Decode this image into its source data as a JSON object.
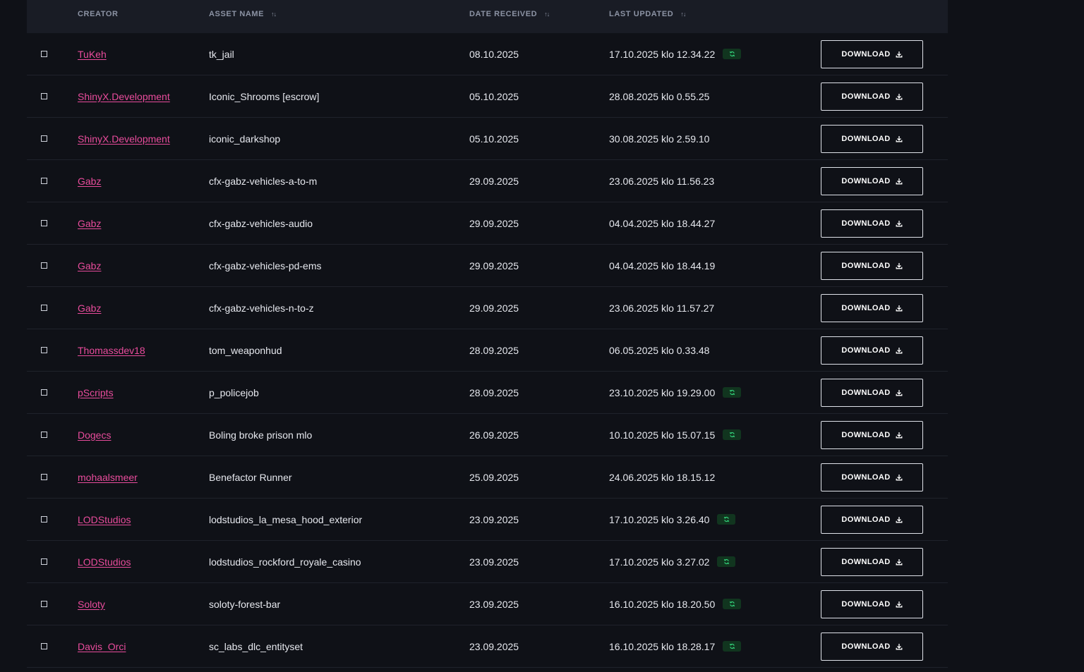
{
  "table": {
    "headers": {
      "creator": "CREATOR",
      "asset_name": "ASSET NAME",
      "date_received": "DATE RECEIVED",
      "last_updated": "LAST UPDATED"
    },
    "download_label": "DOWNLOAD",
    "accent_link_color": "#e94c9c",
    "updated_badge_color": "#11351f",
    "rows": [
      {
        "creator": "TuKeh",
        "asset": "tk_jail",
        "received": "08.10.2025",
        "updated": "17.10.2025 klo 12.34.22",
        "recently_updated": true
      },
      {
        "creator": "ShinyX.Development",
        "asset": "Iconic_Shrooms [escrow]",
        "received": "05.10.2025",
        "updated": "28.08.2025 klo 0.55.25",
        "recently_updated": false
      },
      {
        "creator": "ShinyX.Development",
        "asset": "iconic_darkshop",
        "received": "05.10.2025",
        "updated": "30.08.2025 klo 2.59.10",
        "recently_updated": false
      },
      {
        "creator": "Gabz",
        "asset": "cfx-gabz-vehicles-a-to-m",
        "received": "29.09.2025",
        "updated": "23.06.2025 klo 11.56.23",
        "recently_updated": false
      },
      {
        "creator": "Gabz",
        "asset": "cfx-gabz-vehicles-audio",
        "received": "29.09.2025",
        "updated": "04.04.2025 klo 18.44.27",
        "recently_updated": false
      },
      {
        "creator": "Gabz",
        "asset": "cfx-gabz-vehicles-pd-ems",
        "received": "29.09.2025",
        "updated": "04.04.2025 klo 18.44.19",
        "recently_updated": false
      },
      {
        "creator": "Gabz",
        "asset": "cfx-gabz-vehicles-n-to-z",
        "received": "29.09.2025",
        "updated": "23.06.2025 klo 11.57.27",
        "recently_updated": false
      },
      {
        "creator": "Thomassdev18",
        "asset": "tom_weaponhud",
        "received": "28.09.2025",
        "updated": "06.05.2025 klo 0.33.48",
        "recently_updated": false
      },
      {
        "creator": "pScripts",
        "asset": "p_policejob",
        "received": "28.09.2025",
        "updated": "23.10.2025 klo 19.29.00",
        "recently_updated": true
      },
      {
        "creator": "Dogecs",
        "asset": "Boling broke prison mlo",
        "received": "26.09.2025",
        "updated": "10.10.2025 klo 15.07.15",
        "recently_updated": true
      },
      {
        "creator": "mohaalsmeer",
        "asset": "Benefactor Runner",
        "received": "25.09.2025",
        "updated": "24.06.2025 klo 18.15.12",
        "recently_updated": false
      },
      {
        "creator": "LODStudios",
        "asset": "lodstudios_la_mesa_hood_exterior",
        "received": "23.09.2025",
        "updated": "17.10.2025 klo 3.26.40",
        "recently_updated": true
      },
      {
        "creator": "LODStudios",
        "asset": "lodstudios_rockford_royale_casino",
        "received": "23.09.2025",
        "updated": "17.10.2025 klo 3.27.02",
        "recently_updated": true
      },
      {
        "creator": "Soloty",
        "asset": "soloty-forest-bar",
        "received": "23.09.2025",
        "updated": "16.10.2025 klo 18.20.50",
        "recently_updated": true
      },
      {
        "creator": "Davis_Orci",
        "asset": "sc_labs_dlc_entityset",
        "received": "23.09.2025",
        "updated": "16.10.2025 klo 18.28.17",
        "recently_updated": true
      }
    ]
  }
}
